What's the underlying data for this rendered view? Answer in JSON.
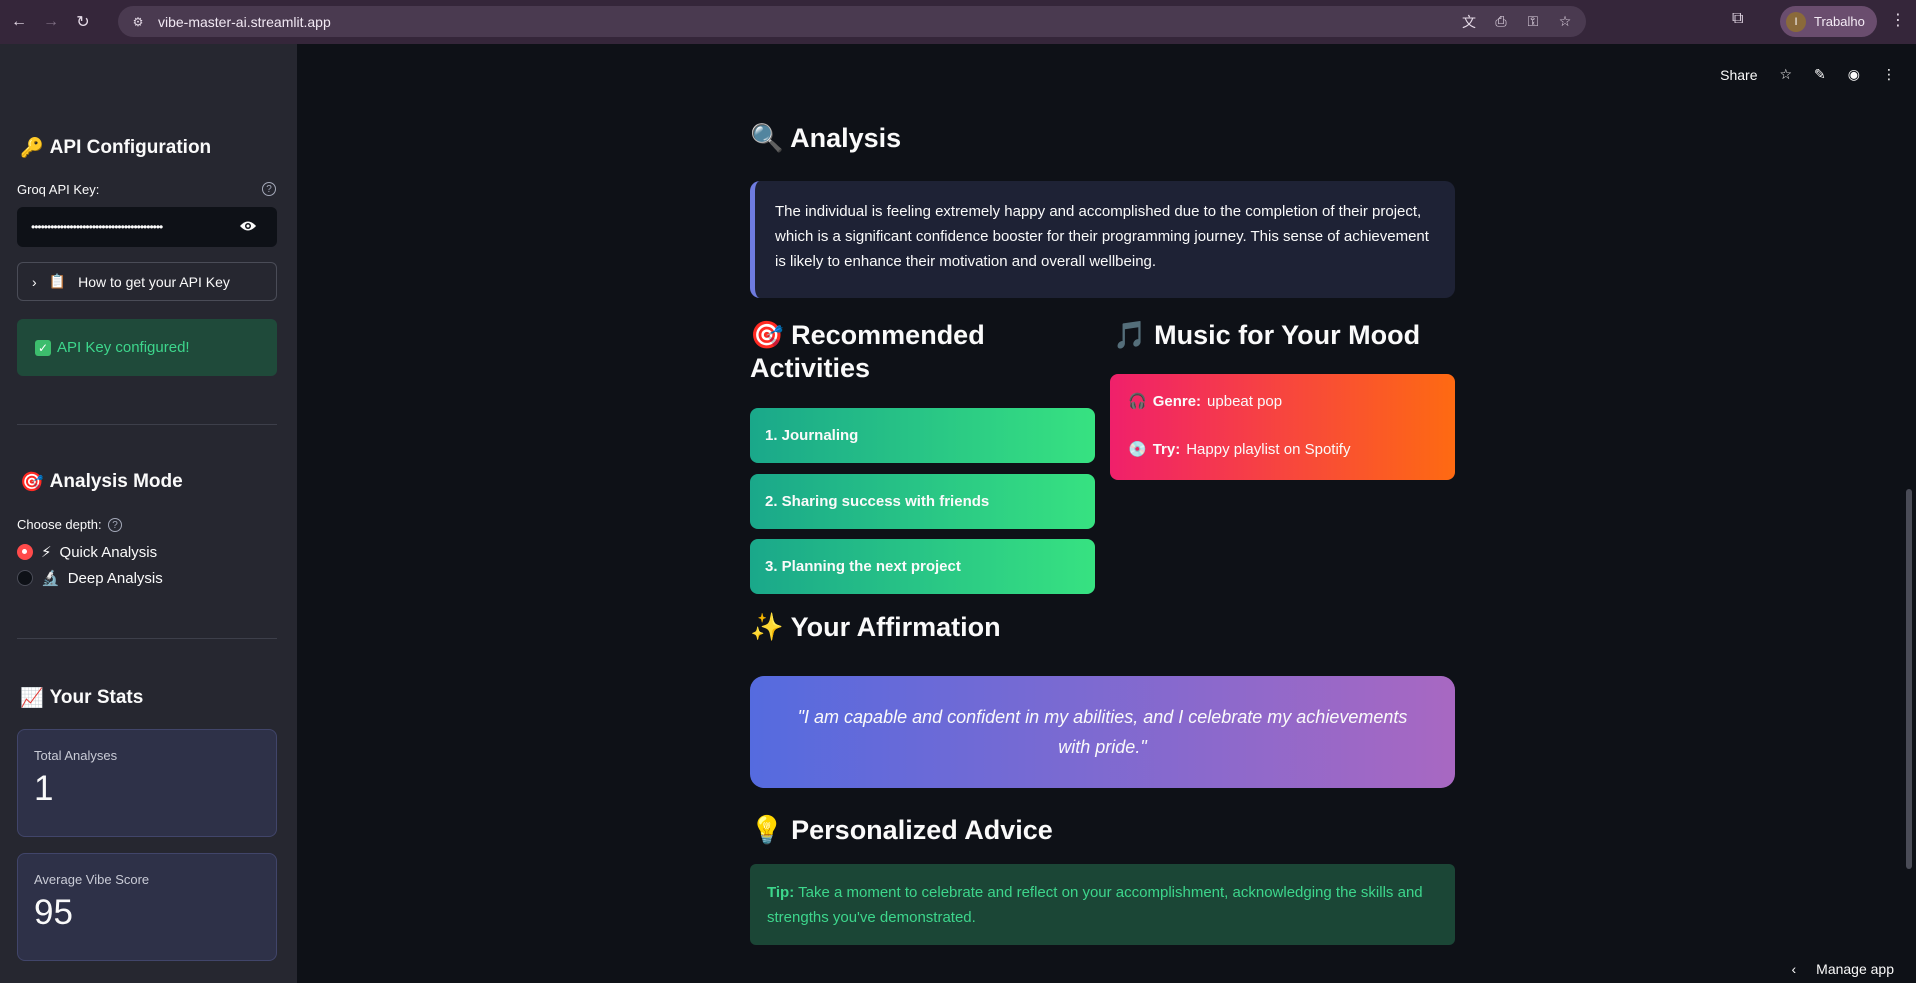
{
  "browser": {
    "url": "vibe-master-ai.streamlit.app",
    "profile_initial": "I",
    "profile_name": "Trabalho"
  },
  "sidebar": {
    "api_config_title": "API Configuration",
    "api_config_emoji": "🔑",
    "api_key_label": "Groq API Key:",
    "api_key_value": "•••••••••••••••••••••••••••••••••••••••••",
    "how_to_label": "How to get your API Key",
    "how_to_emoji": "📋",
    "success_text": "API Key configured!",
    "analysis_mode_title": "Analysis Mode",
    "analysis_mode_emoji": "🎯",
    "choose_depth_label": "Choose depth:",
    "options": [
      {
        "emoji": "⚡",
        "label": "Quick Analysis",
        "checked": true
      },
      {
        "emoji": "🔬",
        "label": "Deep Analysis",
        "checked": false
      }
    ],
    "stats_title": "Your Stats",
    "stats_emoji": "📈",
    "metrics": [
      {
        "label": "Total Analyses",
        "value": "1"
      },
      {
        "label": "Average Vibe Score",
        "value": "95"
      }
    ]
  },
  "toolbar": {
    "share_label": "Share"
  },
  "main": {
    "analysis_title": "Analysis",
    "analysis_emoji": "🔍",
    "analysis_text": "The individual is feeling extremely happy and accomplished due to the completion of their project, which is a significant confidence booster for their programming journey. This sense of achievement is likely to enhance their motivation and overall wellbeing.",
    "activities_title": "Recommended Activities",
    "activities_emoji": "🎯",
    "activities": [
      "1. Journaling",
      "2. Sharing success with friends",
      "3. Planning the next project"
    ],
    "music_title": "Music for Your Mood",
    "music_emoji": "🎵",
    "genre_label": "Genre:",
    "genre_value": "upbeat pop",
    "try_label": "Try:",
    "try_value": "Happy playlist on Spotify",
    "affirmation_title": "Your Affirmation",
    "affirmation_emoji": "✨",
    "affirmation_text": "\"I am capable and confident in my abilities, and I celebrate my achievements with pride.\"",
    "advice_title": "Personalized Advice",
    "advice_emoji": "💡",
    "advice_tip_label": "Tip:",
    "advice_text": "Take a moment to celebrate and reflect on your accomplishment, acknowledging the skills and strengths you've demonstrated."
  },
  "footer": {
    "manage_app_label": "Manage app"
  }
}
